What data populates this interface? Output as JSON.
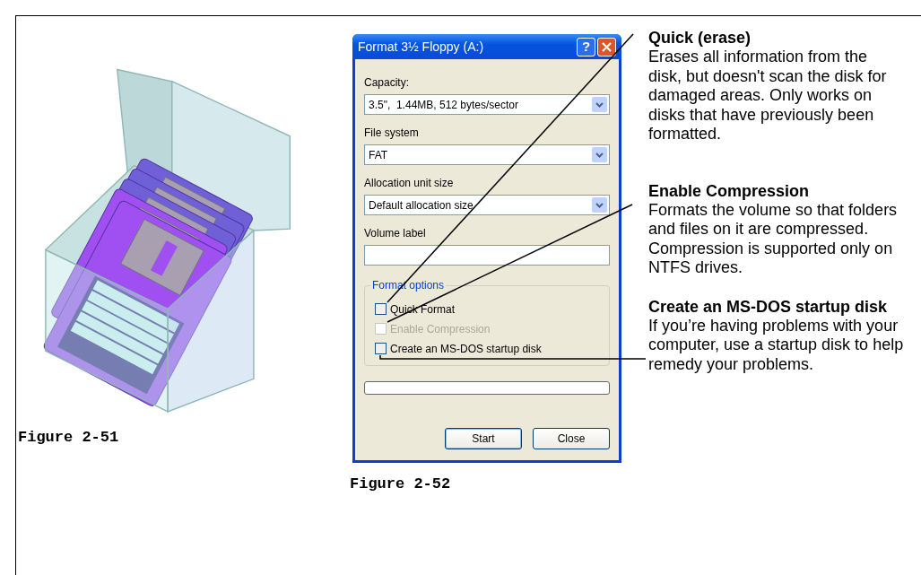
{
  "figures": [
    {
      "caption": "Figure 2-51"
    },
    {
      "caption": "Figure 2-52"
    }
  ],
  "dialog": {
    "title": "Format 3½ Floppy (A:)",
    "help": "?",
    "fields": [
      {
        "label": "Capacity:",
        "kind": "dropdown",
        "value": "3.5\",  1.44MB, 512 bytes/sector"
      },
      {
        "label": "File system",
        "kind": "dropdown",
        "value": "FAT"
      },
      {
        "label": "Allocation unit size",
        "kind": "dropdown",
        "value": "Default allocation size"
      },
      {
        "label": "Volume label",
        "kind": "text"
      }
    ],
    "group": {
      "legend": "Format options",
      "options": [
        {
          "label": "Quick Format",
          "checked": false,
          "disabled": false
        },
        {
          "label": "Enable Compression",
          "checked": false,
          "disabled": true
        },
        {
          "label": "Create an MS-DOS startup disk",
          "checked": false,
          "disabled": false
        }
      ]
    },
    "progress": {
      "level": 0
    },
    "buttons": [
      "Start",
      "Close"
    ]
  },
  "notes": [
    {
      "heading": "Quick (erase)",
      "text": "Erases all information from the disk, but doesn't scan the disk for damaged areas. Only works on disks that have previously been formatted."
    },
    {
      "heading": "Enable Compression",
      "text": "Formats the volume so that folders and files on it are compressed. Compression is supported only on NTFS drives."
    },
    {
      "heading": "Create an MS-DOS startup disk",
      "text": "If you’re having problems with your computer, use a startup disk to help remedy your problems."
    }
  ]
}
